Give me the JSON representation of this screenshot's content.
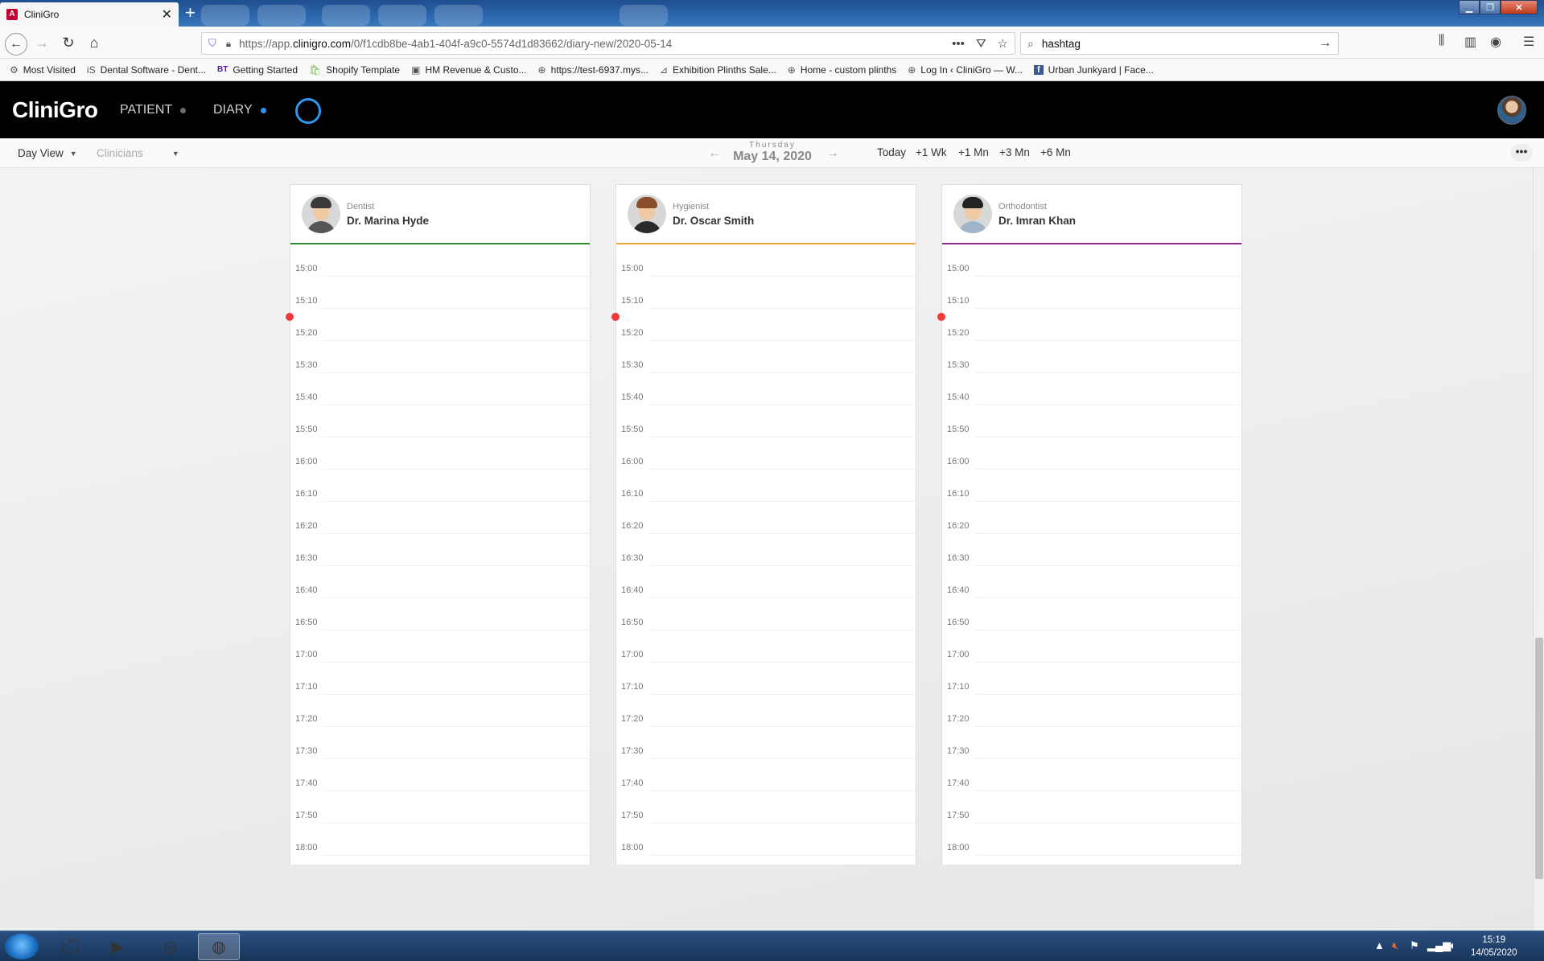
{
  "browser": {
    "tab_title": "CliniGro",
    "tab_favicon": "A",
    "url_prefix": "https://app.",
    "url_domain": "clinigro.com",
    "url_path": "/0/f1cdb8be-4ab1-404f-a9c0-5574d1d83662/diary-new/2020-05-14",
    "search_value": "hashtag",
    "bookmarks": [
      {
        "label": "Most Visited",
        "icon": "gear-icon"
      },
      {
        "label": "Dental Software - Dent...",
        "icon": "is-logo-icon"
      },
      {
        "label": "Getting Started",
        "icon": "bt-logo-icon"
      },
      {
        "label": "Shopify Template",
        "icon": "shopify-icon"
      },
      {
        "label": "HM Revenue & Custo...",
        "icon": "hmrc-icon"
      },
      {
        "label": "https://test-6937.mys...",
        "icon": "globe-icon"
      },
      {
        "label": "Exhibition Plinths Sale...",
        "icon": "plinth-icon"
      },
      {
        "label": "Home - custom plinths",
        "icon": "globe-icon"
      },
      {
        "label": "Log In ‹ CliniGro — W...",
        "icon": "globe-icon"
      },
      {
        "label": "Urban Junkyard | Face...",
        "icon": "facebook-icon"
      }
    ]
  },
  "app": {
    "logo": "CliniGro",
    "nav": [
      {
        "label": "PATIENT",
        "dot_color": "#6b6b6b"
      },
      {
        "label": "DIARY",
        "dot_color": "#2f96ef"
      }
    ]
  },
  "toolbar": {
    "view": "Day View",
    "clinicians": "Clinicians",
    "weekday": "Thursday",
    "date": "May 14, 2020",
    "quick": [
      "Today",
      "+1 Wk",
      "+1 Mn",
      "+3 Mn",
      "+6 Mn"
    ],
    "more": "•••"
  },
  "clinicians": [
    {
      "role": "Dentist",
      "name": "Dr. Marina Hyde",
      "color": "#2e8b2e",
      "hair": "#3a3a3a",
      "body": "#555555"
    },
    {
      "role": "Hygienist",
      "name": "Dr. Oscar Smith",
      "color": "#f2a53a",
      "hair": "#8a4f2a",
      "body": "#2b2b2b"
    },
    {
      "role": "Orthodontist",
      "name": "Dr. Imran Khan",
      "color": "#8b2a8b",
      "hair": "#222222",
      "body": "#9fb4c6"
    }
  ],
  "times": [
    "15:00",
    "15:10",
    "15:20",
    "15:30",
    "15:40",
    "15:50",
    "16:00",
    "16:10",
    "16:20",
    "16:30",
    "16:40",
    "16:50",
    "17:00",
    "17:10",
    "17:20",
    "17:30",
    "17:40",
    "17:50",
    "18:00"
  ],
  "now_indicator_color": "#f03a3a",
  "taskbar": {
    "time": "15:19",
    "date": "14/05/2020"
  }
}
